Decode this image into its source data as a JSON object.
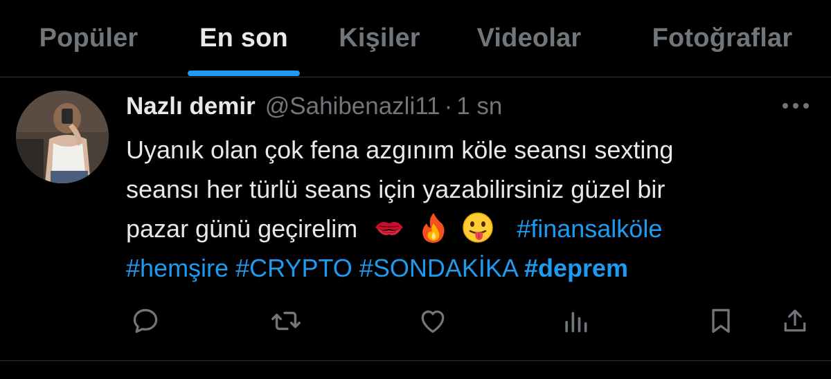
{
  "tabs": [
    {
      "label": "Popüler",
      "active": false
    },
    {
      "label": "En son",
      "active": true
    },
    {
      "label": "Kişiler",
      "active": false
    },
    {
      "label": "Videolar",
      "active": false
    },
    {
      "label": "Fotoğraflar",
      "active": false
    }
  ],
  "tweet": {
    "display_name": "Nazlı demir",
    "handle": "@Sahibenazli11",
    "separator": "·",
    "time": "1 sn",
    "text_line1": "Uyanık olan çok fena azgınım köle seansı sexting",
    "text_line2": "seansı her türlü seans için yazabilirsiniz güzel bir",
    "text_line3": "pazar günü geçirelim",
    "emojis": [
      "kiss-mark",
      "fire",
      "face-with-tongue"
    ],
    "hashtags": [
      "#finansalköle",
      "#hemşire",
      "#CRYPTO",
      "#SONDAKİKA",
      "#deprem"
    ]
  },
  "actions": [
    "reply-icon",
    "retweet-icon",
    "like-icon",
    "views-icon",
    "bookmark-icon",
    "share-icon"
  ],
  "colors": {
    "background": "#000000",
    "accent": "#1d9bf0",
    "text_primary": "#e7e9ea",
    "text_secondary": "#71767b",
    "border": "#2f3336"
  }
}
